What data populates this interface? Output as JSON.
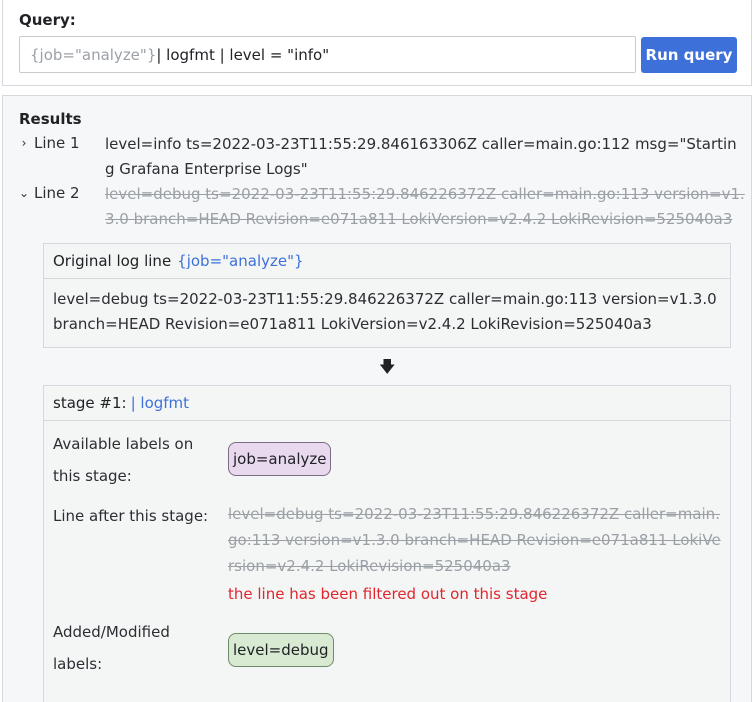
{
  "query": {
    "label": "Query:",
    "selector": "{job=\"analyze\"}",
    "rest": " | logfmt | level = \"info\"",
    "run_button": "Run query"
  },
  "results": {
    "title": "Results",
    "lines": [
      {
        "label": "Line 1",
        "expanded": false,
        "text": "level=info ts=2022-03-23T11:55:29.846163306Z caller=main.go:112 msg=\"Starting Grafana Enterprise Logs\"",
        "filtered": false
      },
      {
        "label": "Line 2",
        "expanded": true,
        "text": "level=debug ts=2022-03-23T11:55:29.846226372Z caller=main.go:113 version=v1.3.0 branch=HEAD Revision=e071a811 LokiVersion=v2.4.2 LokiRevision=525040a3",
        "filtered": true
      }
    ],
    "original": {
      "title": "Original log line",
      "selector": "{job=\"analyze\"}",
      "text": "level=debug ts=2022-03-23T11:55:29.846226372Z caller=main.go:113 version=v1.3.0 branch=HEAD Revision=e071a811 LokiVersion=v2.4.2 LokiRevision=525040a3"
    },
    "stage": {
      "title": "stage #1:",
      "expression": "| logfmt",
      "available_labels_label": "Available labels on this stage:",
      "available_labels": [
        "job=analyze"
      ],
      "line_after_label": "Line after this stage:",
      "line_after": "level=debug ts=2022-03-23T11:55:29.846226372Z caller=main.go:113 version=v1.3.0 branch=HEAD Revision=e071a811 LokiVersion=v2.4.2 LokiRevision=525040a3",
      "filtered_message": "the line has been filtered out on this stage",
      "added_labels_label": "Added/Modified labels:",
      "added_labels": [
        "level=debug"
      ]
    }
  },
  "icons": {
    "collapsed": "chevron-right-icon",
    "expanded": "chevron-down-icon",
    "arrow": "arrow-down-icon"
  },
  "colors": {
    "accent": "#3d71d9",
    "error": "#e0262f",
    "chip_purple": "#e8d9ee",
    "chip_green": "#d8ead2"
  }
}
